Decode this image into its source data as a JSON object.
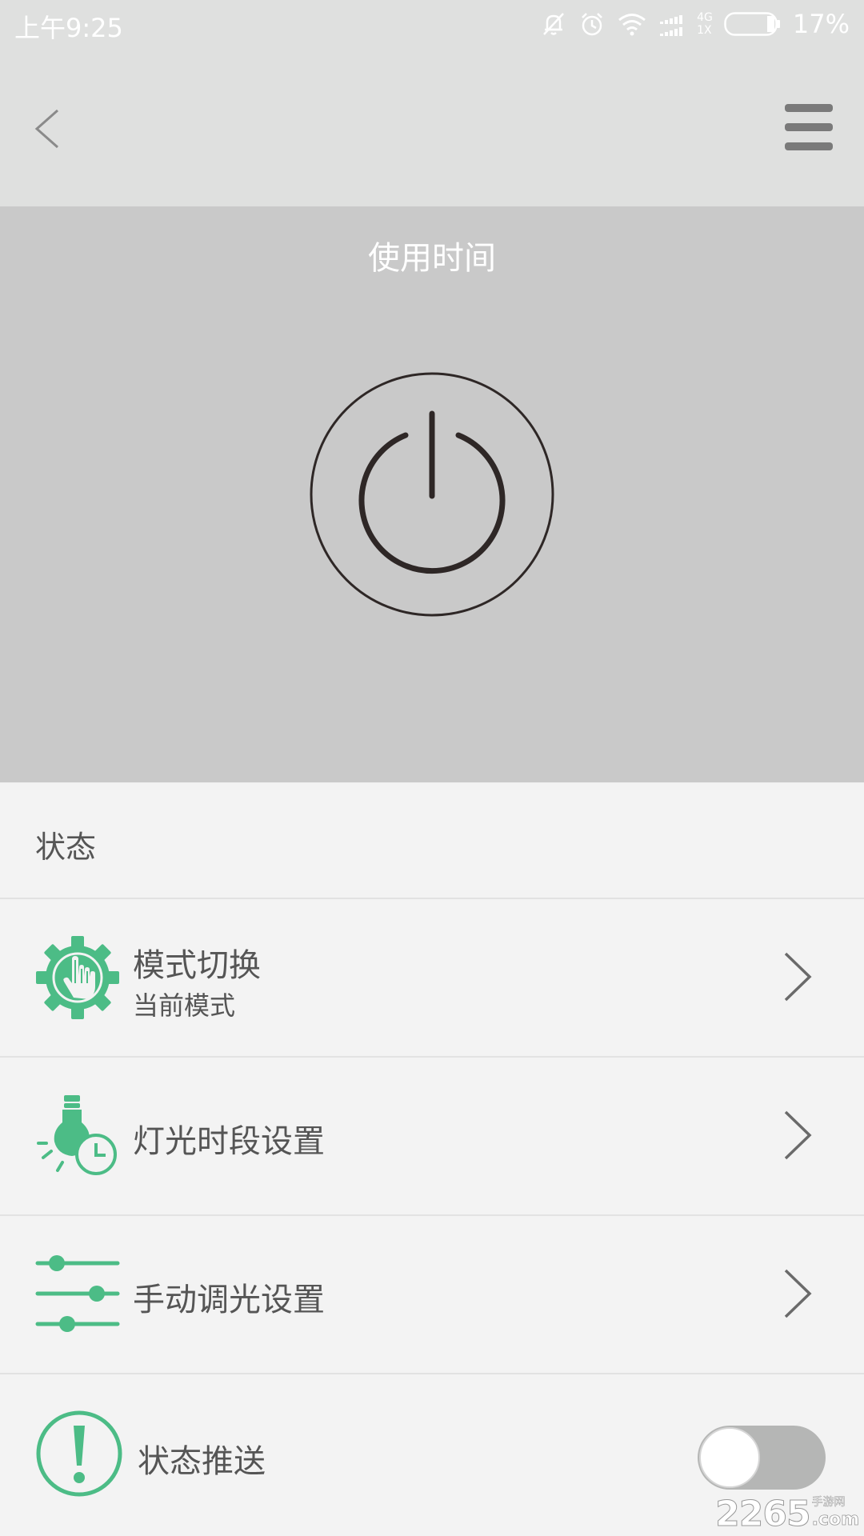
{
  "status_bar": {
    "time": "上午9:25",
    "network_top": "4G",
    "network_bottom": "1X",
    "battery": "17%",
    "icons": [
      "mute-icon",
      "alarm-icon",
      "wifi-icon",
      "signal-icon",
      "battery-icon"
    ]
  },
  "nav": {
    "back_icon": "chevron-left-icon",
    "menu_icon": "hamburger-menu-icon"
  },
  "hero": {
    "title": "使用时间",
    "power_icon": "power-icon"
  },
  "section": {
    "status_label": "状态"
  },
  "rows": [
    {
      "title": "模式切换",
      "subtitle": "当前模式",
      "icon": "gear-hand-icon"
    },
    {
      "title": "灯光时段设置",
      "icon": "bulb-clock-icon"
    },
    {
      "title": "手动调光设置",
      "icon": "sliders-icon"
    },
    {
      "title": "状态推送",
      "icon": "exclamation-circle-icon",
      "toggle_on": false
    }
  ],
  "watermark": {
    "main": "2265",
    "cn": "手游网",
    "domain": ".com"
  },
  "colors": {
    "accent_green": "#4cbc86",
    "hero_bg": "#c9c9c9",
    "bar_bg": "#dfe0df",
    "text": "#555555"
  }
}
